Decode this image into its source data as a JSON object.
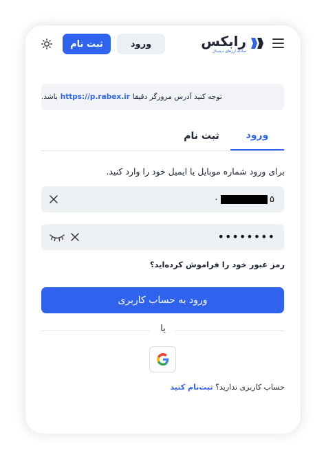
{
  "header": {
    "logo_name": "رابکس",
    "logo_tagline": "مبادله ارزهای دیجیتال",
    "login_label": "ورود",
    "signup_label": "ثبت نام"
  },
  "notice": {
    "prefix": "توجه کنید آدرس مرورگر دقیقا",
    "url": "https://p.rabex.ir",
    "suffix": "باشد."
  },
  "tabs": [
    {
      "label": "ورود",
      "active": true
    },
    {
      "label": "ثبت نام",
      "active": false
    }
  ],
  "form": {
    "instruction": "برای ورود شماره موبایل یا ایمیل خود را وارد کنید.",
    "phone_prefix": "۰",
    "phone_suffix": "۵",
    "password_value": "••••••••",
    "forgot_label": "رمز عبور خود را فراموش کرده‌اید؟",
    "submit_label": "ورود به حساب کاربری",
    "or_label": "یا",
    "no_account_text": "حساب کاربری ندارید؟",
    "signup_link": "ثبت‌نام کنید"
  },
  "colors": {
    "primary": "#2f63ee",
    "text": "#1d2333",
    "field_bg": "#eef1f4"
  }
}
